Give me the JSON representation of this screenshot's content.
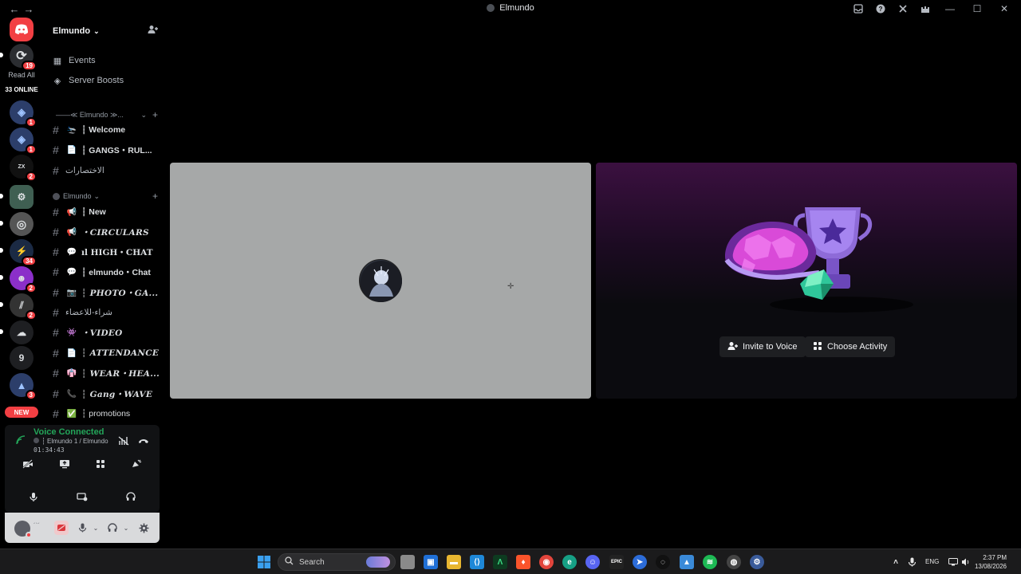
{
  "window": {
    "title": "Elmundo",
    "nav_back": "←",
    "nav_forward": "→",
    "icons": [
      "inbox-icon",
      "help-icon",
      "tools-icon",
      "castle-icon"
    ],
    "controls": {
      "minimize": "—",
      "maximize": "☐",
      "close": "✕"
    }
  },
  "rail": {
    "read_all": "Read All",
    "online": "33 ONLINE",
    "new_label": "NEW",
    "servers": [
      {
        "badge": "19"
      },
      {
        "badge": "1"
      },
      {
        "badge": "1"
      },
      {
        "badge": "2"
      },
      {
        "badge": ""
      },
      {
        "badge": ""
      },
      {
        "badge": "34"
      },
      {
        "badge": "2"
      },
      {
        "badge": "2"
      },
      {
        "badge": ""
      },
      {
        "letter": "9",
        "badge": ""
      },
      {
        "badge": "3"
      }
    ]
  },
  "sidebar": {
    "server_name": "Elmundo",
    "events": "Events",
    "server_boosts": "Server Boosts",
    "category1": "——≪ Elmundo ≫...",
    "category2": "Elmundo",
    "channels": [
      {
        "emoji": "🛬",
        "name": "┆ Welcome"
      },
      {
        "emoji": "📄",
        "name": "┆ GANGS・RUL..."
      },
      {
        "emoji": "",
        "name": "الاختصارات"
      },
      {
        "emoji": "📢",
        "name": "┆ New"
      },
      {
        "emoji": "📢",
        "name": "・CIRCULARS"
      },
      {
        "emoji": "💬",
        "name": "ıl HIGH・CHAT"
      },
      {
        "emoji": "💬",
        "name": "┆ elmundo・Chat"
      },
      {
        "emoji": "📷",
        "name": "┆ PHOTO・GA..."
      },
      {
        "emoji": "",
        "name": "شراء-للاعضاء"
      },
      {
        "emoji": "👾",
        "name": "・VIDEO"
      },
      {
        "emoji": "📄",
        "name": "┆ ATTENDANCE"
      },
      {
        "emoji": "👘",
        "name": "┆ WEAR・HEA..."
      },
      {
        "emoji": "📞",
        "name": "┆ Gang・WAVE"
      },
      {
        "emoji": "✅",
        "name": "┆ promotions"
      }
    ]
  },
  "voice": {
    "status": "Voice Connected",
    "channel": "┆ Elmundo 1 / Elmundo",
    "elapsed": "01:34:43"
  },
  "user": {
    "name": "´`´"
  },
  "stage": {
    "invite_label": "Invite to Voice",
    "activity_label": "Choose Activity"
  },
  "taskbar": {
    "search_placeholder": "Search",
    "lang": "ENG",
    "time": "2:37 PM",
    "date": "13/08/2026"
  },
  "colors": {
    "accent_green": "#23a559",
    "badge_red": "#f23f43",
    "purple_gradient": "#3b1040"
  }
}
